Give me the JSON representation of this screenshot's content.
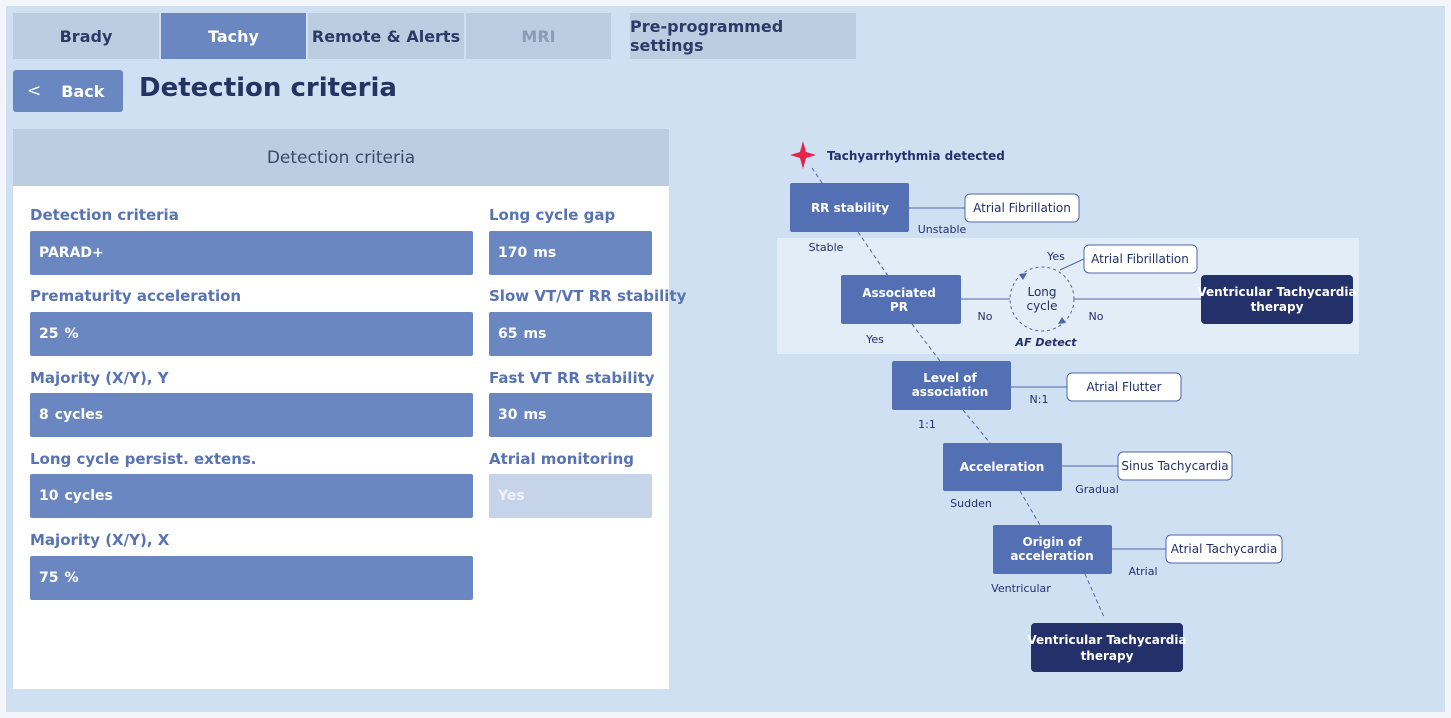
{
  "tabs": [
    {
      "label": "Brady"
    },
    {
      "label": "Tachy"
    },
    {
      "label": "Remote & Alerts"
    },
    {
      "label": "MRI"
    },
    {
      "label": "Pre-programmed settings"
    }
  ],
  "header": {
    "back_label": "Back",
    "title": "Detection criteria"
  },
  "panel": {
    "title": "Detection criteria",
    "fields": [
      {
        "label": "Detection criteria",
        "value": "PARAD+",
        "unit": ""
      },
      {
        "label": "Long cycle gap",
        "value": "170",
        "unit": "ms"
      },
      {
        "label": "Prematurity acceleration",
        "value": "25",
        "unit": "%"
      },
      {
        "label": "Slow VT/VT RR stability",
        "value": "65",
        "unit": "ms"
      },
      {
        "label": "Majority (X/Y), Y",
        "value": "8",
        "unit": "cycles"
      },
      {
        "label": "Fast VT RR stability",
        "value": "30",
        "unit": "ms"
      },
      {
        "label": "Long cycle persist. extens.",
        "value": "10",
        "unit": "cycles"
      },
      {
        "label": "Atrial monitoring",
        "value": "Yes",
        "unit": ""
      },
      {
        "label": "Majority (X/Y), X",
        "value": "75",
        "unit": "%"
      }
    ]
  },
  "diagram": {
    "start": "Tachyarrhythmia detected",
    "rr_stability": "RR stability",
    "unstable": "Unstable",
    "stable": "Stable",
    "af1": "Atrial Fibrillation",
    "associated_pr": [
      "Associated",
      "PR"
    ],
    "no1": "No",
    "long_cycle": [
      "Long",
      "cycle"
    ],
    "yes_lc": "Yes",
    "af2": "Atrial Fibrillation",
    "no2": "No",
    "vt_therapy_1": [
      "Ventricular Tachycardia",
      "therapy"
    ],
    "af_detect": "AF Detect",
    "yes_pr": "Yes",
    "level_assoc": [
      "Level of",
      "association"
    ],
    "n1": "N:1",
    "aflutter": "Atrial Flutter",
    "one_one": "1:1",
    "acceleration": "Acceleration",
    "gradual": "Gradual",
    "sinus_tachy": "Sinus Tachycardia",
    "sudden": "Sudden",
    "origin_accel": [
      "Origin of",
      "acceleration"
    ],
    "atrial": "Atrial",
    "atrial_tachy": "Atrial Tachycardia",
    "ventricular": "Ventricular",
    "vt_therapy_2": [
      "Ventricular Tachycardia",
      "therapy"
    ]
  },
  "colors": {
    "frame_bg": "#cfe0f3",
    "tab_bg": "#bccde2",
    "tab_active": "#6a87c1",
    "field_bg": "#6a87c1",
    "node_box": "#5470b5",
    "therapy_box": "#23306a",
    "star": "#e8234a"
  }
}
